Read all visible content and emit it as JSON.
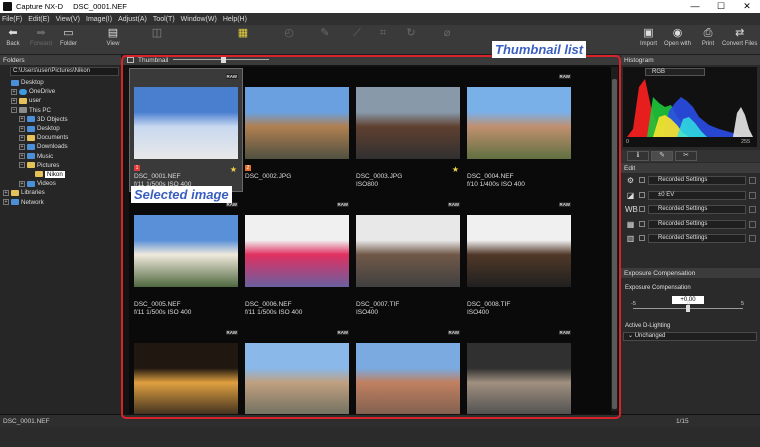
{
  "window": {
    "app_name": "Capture NX-D",
    "file_name": "DSC_0001.NEF",
    "controls": [
      "—",
      "☐",
      "✕"
    ]
  },
  "menu": [
    "File(F)",
    "Edit(E)",
    "View(V)",
    "Image(I)",
    "Adjust(A)",
    "Tool(T)",
    "Window(W)",
    "Help(H)"
  ],
  "toolbar": {
    "back": "Back",
    "forward": "Forward",
    "folder": "Folder",
    "view": "View",
    "import": "Import",
    "open_with": "Open with",
    "print": "Print",
    "convert": "Convert Files"
  },
  "folders": {
    "title": "Folders",
    "path": "C:\\Users\\user\\Pictures\\Nikon",
    "tree": [
      {
        "label": "Desktop",
        "level": 0,
        "icon": "blue",
        "exp": ""
      },
      {
        "label": "OneDrive",
        "level": 1,
        "icon": "cloud",
        "exp": "+"
      },
      {
        "label": "user",
        "level": 1,
        "icon": "yel",
        "exp": "+"
      },
      {
        "label": "This PC",
        "level": 1,
        "icon": "gray",
        "exp": "−"
      },
      {
        "label": "3D Objects",
        "level": 2,
        "icon": "blue",
        "exp": "+"
      },
      {
        "label": "Desktop",
        "level": 2,
        "icon": "blue",
        "exp": "+"
      },
      {
        "label": "Documents",
        "level": 2,
        "icon": "yel",
        "exp": "+"
      },
      {
        "label": "Downloads",
        "level": 2,
        "icon": "blue",
        "exp": "+"
      },
      {
        "label": "Music",
        "level": 2,
        "icon": "blue",
        "exp": "+"
      },
      {
        "label": "Pictures",
        "level": 2,
        "icon": "yel",
        "exp": "−"
      },
      {
        "label": "Nikon",
        "level": 3,
        "icon": "yel",
        "exp": "",
        "selected": true
      },
      {
        "label": "Videos",
        "level": 2,
        "icon": "blue",
        "exp": "+"
      },
      {
        "label": "Libraries",
        "level": 0,
        "icon": "yel",
        "exp": "+"
      },
      {
        "label": "Network",
        "level": 0,
        "icon": "blue",
        "exp": "+"
      }
    ]
  },
  "thumbnail_panel": {
    "title": "Thumbnail"
  },
  "thumbnails": [
    {
      "name": "DSC_0001.NEF",
      "info": "f/11 1/500s ISO 400",
      "raw": "RAW",
      "label": "1",
      "label_color": "r",
      "star": true,
      "selected": true,
      "colors": [
        "#4a7fd0",
        "#c8d8f0",
        "#e8e8e8"
      ]
    },
    {
      "name": "DSC_0002.JPG",
      "info": "",
      "raw": "",
      "label": "2",
      "label_color": "o",
      "star": false,
      "selected": false,
      "colors": [
        "#6aa0e0",
        "#b08050",
        "#505040"
      ]
    },
    {
      "name": "DSC_0003.JPG",
      "info": "ISO800",
      "raw": "",
      "label": "",
      "star": true,
      "selected": false,
      "colors": [
        "#8899aa",
        "#604030",
        "#303030"
      ]
    },
    {
      "name": "DSC_0004.NEF",
      "info": "f/10 1/400s ISO 400",
      "raw": "RAW",
      "label": "",
      "star": false,
      "selected": false,
      "colors": [
        "#7ab0e8",
        "#c09070",
        "#607040"
      ]
    },
    {
      "name": "DSC_0005.NEF",
      "info": "f/11 1/500s ISO 400",
      "raw": "RAW",
      "label": "",
      "star": false,
      "selected": false,
      "colors": [
        "#5a90d8",
        "#f0eadc",
        "#506840"
      ]
    },
    {
      "name": "DSC_0006.NEF",
      "info": "f/11 1/500s ISO 400",
      "raw": "RAW",
      "label": "",
      "star": false,
      "selected": false,
      "colors": [
        "#f0f0f0",
        "#e03060",
        "#6a60a0"
      ]
    },
    {
      "name": "DSC_0007.TIF",
      "info": "ISO400",
      "raw": "RAW",
      "label": "",
      "star": false,
      "selected": false,
      "colors": [
        "#e8e8e8",
        "#705848",
        "#404040"
      ]
    },
    {
      "name": "DSC_0008.TIF",
      "info": "ISO400",
      "raw": "RAW",
      "label": "",
      "star": false,
      "selected": false,
      "colors": [
        "#f0f0f0",
        "#503828",
        "#202020"
      ]
    },
    {
      "name": "",
      "info": "",
      "raw": "RAW",
      "label": "",
      "star": false,
      "selected": false,
      "colors": [
        "#201810",
        "#e0a040",
        "#403020"
      ]
    },
    {
      "name": "",
      "info": "",
      "raw": "RAW",
      "label": "",
      "star": false,
      "selected": false,
      "colors": [
        "#8ab8e8",
        "#c0a080",
        "#707060"
      ]
    },
    {
      "name": "",
      "info": "",
      "raw": "RAW",
      "label": "",
      "star": false,
      "selected": false,
      "colors": [
        "#7aaae0",
        "#c08060",
        "#806050"
      ]
    },
    {
      "name": "",
      "info": "",
      "raw": "RAW",
      "label": "",
      "star": false,
      "selected": false,
      "colors": [
        "#303030",
        "#a09080",
        "#505050"
      ]
    }
  ],
  "histogram": {
    "title": "Histogram",
    "channel": "RGB",
    "min_label": "0",
    "max_label": "255"
  },
  "edit": {
    "title": "Edit",
    "rows": [
      {
        "icon": "gear-icon",
        "glyph": "⚙",
        "value": "Recorded Settings"
      },
      {
        "icon": "exposure-icon",
        "glyph": "◪",
        "value": "±0 EV"
      },
      {
        "icon": "wb-icon",
        "glyph": "WB",
        "value": "Recorded Settings"
      },
      {
        "icon": "picture-control-icon",
        "glyph": "▦",
        "value": "Recorded Settings"
      },
      {
        "icon": "tone-icon",
        "glyph": "▥",
        "value": "Recorded Settings"
      }
    ]
  },
  "exposure": {
    "title": "Exposure Compensation",
    "sub": "Exposure Compensation",
    "value": "+0.00",
    "ticks": [
      "-5",
      "0",
      "5"
    ],
    "adl_title": "Active D-Lighting",
    "adl_value": "Unchanged"
  },
  "status": {
    "file": "DSC_0001.NEF",
    "page": "1/15"
  },
  "callouts": {
    "thumb_list": "Thumbnail list",
    "selected": "Selected image"
  }
}
